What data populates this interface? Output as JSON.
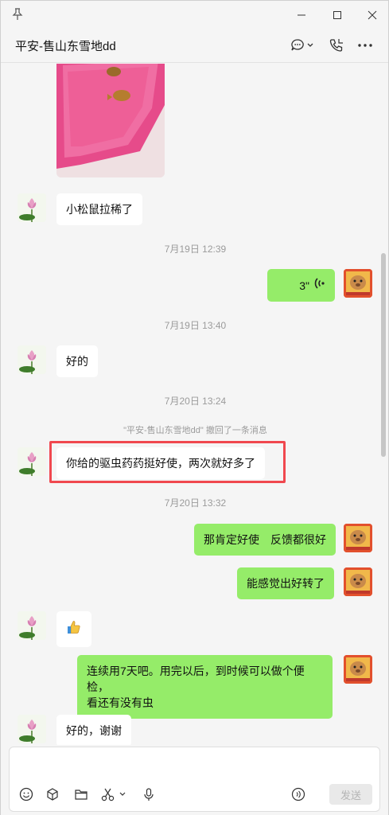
{
  "chat": {
    "title": "平安-售山东雪地dd"
  },
  "messages": {
    "m1_text": "小松鼠拉稀了",
    "ts1": "7月19日 12:39",
    "voice_duration": "3\"",
    "ts2": "7月19日 13:40",
    "m3_text": "好的",
    "ts3": "7月20日 13:24",
    "recall_notice": "\"平安-售山东雪地dd\" 撤回了一条消息",
    "m4_text": "你给的驱虫药药挺好使，两次就好多了",
    "ts4": "7月20日 13:32",
    "m5_text": "那肯定好使　反馈都很好",
    "m6_text": "能感觉出好转了",
    "m7_emoji": "👍",
    "m8_line1": "连续用7天吧。用完以后，到时候可以做个便检，",
    "m8_line2": "看还有没有虫",
    "m9_text": "好的，谢谢"
  },
  "input": {
    "send_label": "发送"
  },
  "colors": {
    "bubble_self": "#95ec69",
    "bubble_other": "#ffffff",
    "highlight": "#f0484f"
  }
}
